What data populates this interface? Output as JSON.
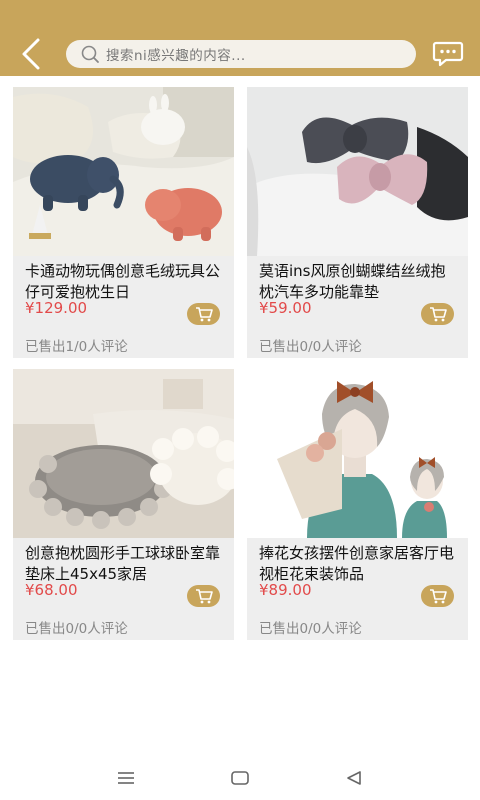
{
  "header": {
    "search_placeholder": "搜索ni感兴趣的内容...",
    "accent_color": "#c8a55b",
    "icons": [
      "back-arrow-icon",
      "search-icon",
      "message-icon"
    ]
  },
  "products": [
    {
      "title": "卡通动物玩偶创意毛绒玩具公仔可爱抱枕生日",
      "price": "¥129.00",
      "sold": "已售出1/0人评论"
    },
    {
      "title": "莫语ins风原创蝴蝶结丝绒抱枕汽车多功能靠垫",
      "price": "¥59.00",
      "sold": "已售出0/0人评论"
    },
    {
      "title": " 创意抱枕圆形手工球球卧室靠垫床上45x45家居",
      "price": "¥68.00",
      "sold": "已售出0/0人评论"
    },
    {
      "title": "捧花女孩摆件创意家居客厅电视柜花束装饰品",
      "price": "¥89.00",
      "sold": "已售出0/0人评论"
    }
  ],
  "system_nav": {
    "icons": [
      "menu-icon",
      "home-icon",
      "back-icon"
    ]
  }
}
